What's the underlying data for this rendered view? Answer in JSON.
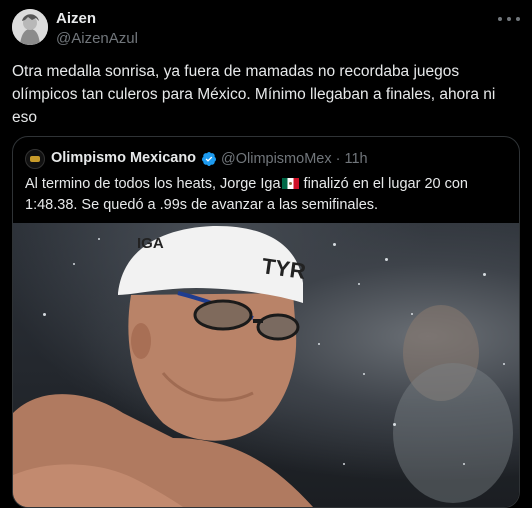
{
  "author": {
    "display_name": "Aizen",
    "handle": "@AizenAzul"
  },
  "tweet": {
    "text": "Otra medalla sonrisa, ya fuera de mamadas no recordaba juegos olímpicos tan culeros para México. Mínimo llegaban a finales, ahora ni eso"
  },
  "quoted": {
    "display_name": "Olimpismo Mexicano",
    "handle": "@OlimpismoMex",
    "separator": "·",
    "time": "11h",
    "text_before_flag": "Al termino de todos los heats, Jorge Iga",
    "text_after_flag": " finalizó en el lugar 20 con 1:48.38. Se quedó a .99s de avanzar a las semifinales.",
    "media": {
      "cap_text_left": "IGA",
      "cap_text_right": "TYR"
    }
  },
  "icons": {
    "more": "more-horizontal-icon",
    "verified": "verified-badge-icon",
    "flag": "mexico-flag-icon"
  },
  "colors": {
    "background": "#000000",
    "text": "#e7e9ea",
    "muted": "#71767b",
    "verified": "#1d9bf0"
  }
}
